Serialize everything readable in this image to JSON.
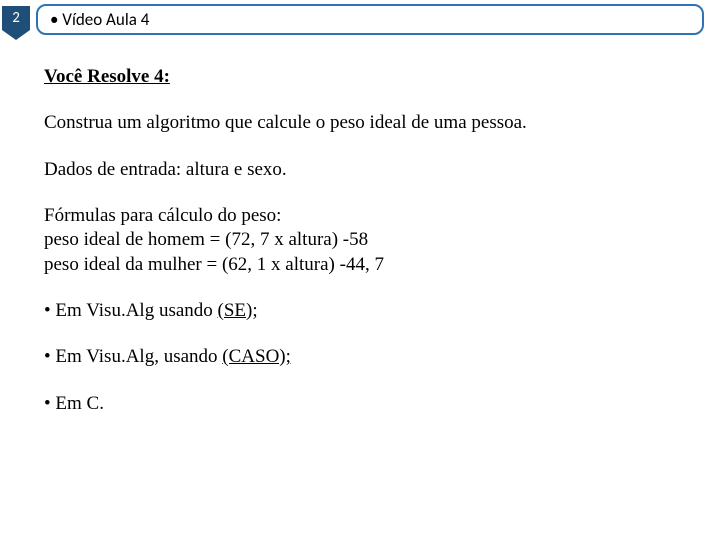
{
  "header": {
    "badge_number": "2",
    "title": "• Vídeo Aula 4"
  },
  "body": {
    "subtitle": "Você Resolve 4:",
    "p1": "Construa um algoritmo que calcule o peso ideal de uma pessoa.",
    "p2": "Dados de entrada: altura e sexo.",
    "formula_heading": "Fórmulas para cálculo do peso:",
    "formula_h": "peso ideal de homem = (72, 7 x altura) -58",
    "formula_m": "peso ideal da mulher = (62, 1 x altura) -44, 7",
    "bullet1_prefix": "• Em Visu.Alg usando ",
    "bullet1_u": "(SE);",
    "bullet2_prefix": "• Em Visu.Alg, usando ",
    "bullet2_u": "(CASO);",
    "bullet3": "• Em C."
  }
}
